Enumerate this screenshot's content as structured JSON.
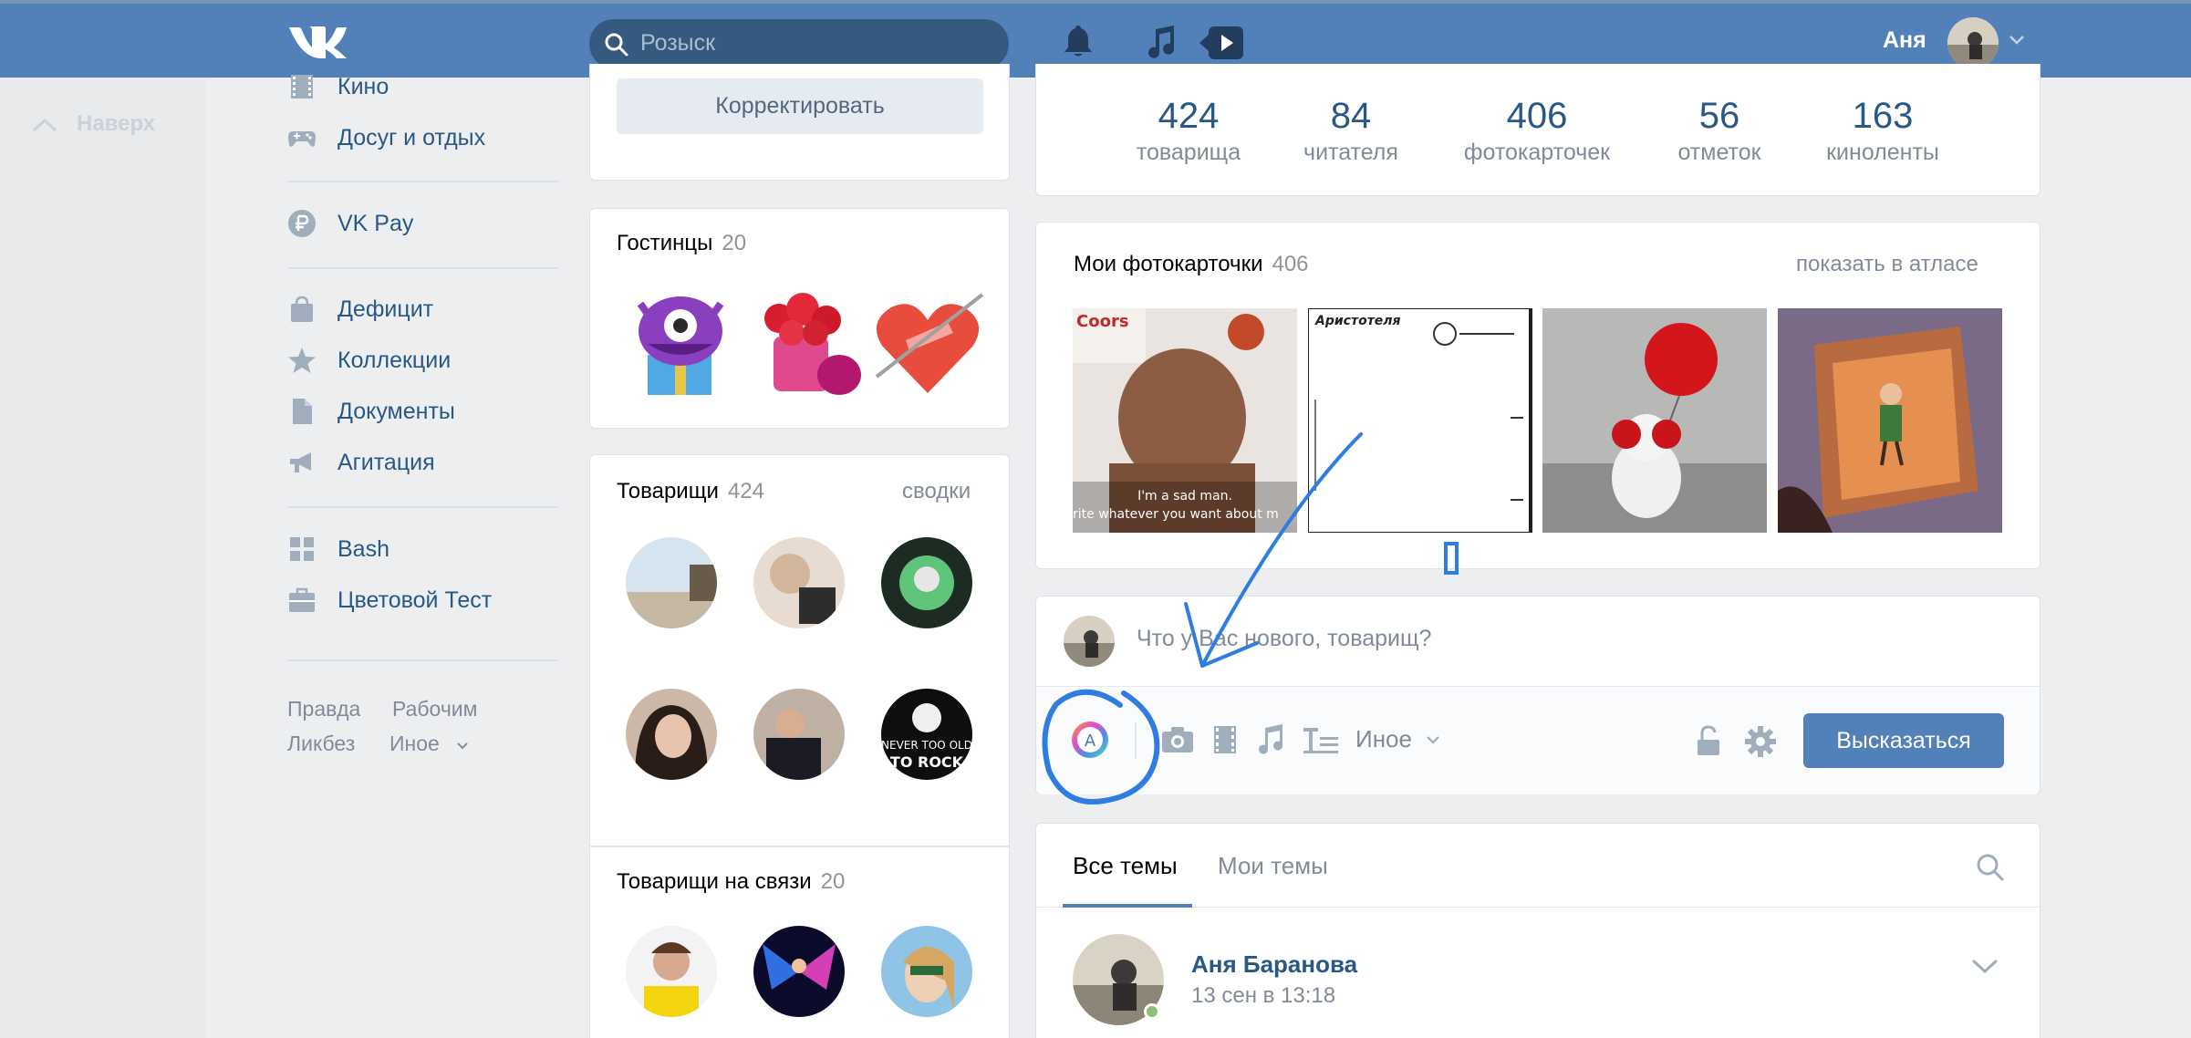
{
  "header": {
    "logo": "VK",
    "search_placeholder": "Розыск",
    "user_name": "Аня"
  },
  "back_to_top": "Наверх",
  "left_menu": {
    "items": [
      {
        "label": "Кино",
        "icon": "film-icon"
      },
      {
        "label": "Досуг и отдых",
        "icon": "gamepad-icon"
      },
      {
        "label": "VK Pay",
        "icon": "ruble-icon"
      },
      {
        "label": "Дефицит",
        "icon": "bag-icon"
      },
      {
        "label": "Коллекции",
        "icon": "star-icon"
      },
      {
        "label": "Документы",
        "icon": "document-icon"
      },
      {
        "label": "Агитация",
        "icon": "megaphone-icon"
      },
      {
        "label": "Bash",
        "icon": "apps-icon"
      },
      {
        "label": "Цветовой Тест",
        "icon": "briefcase-icon"
      }
    ],
    "footer": [
      "Правда",
      "Рабочим",
      "Ликбез",
      "Иное"
    ]
  },
  "profile": {
    "edit_button": "Корректировать"
  },
  "gifts": {
    "title": "Гостинцы",
    "count": "20"
  },
  "friends": {
    "title": "Товарищи",
    "count": "424",
    "link": "сводки"
  },
  "friends_online": {
    "title": "Товарищи на связи",
    "count": "20"
  },
  "stats": [
    {
      "value": "424",
      "label": "товарища"
    },
    {
      "value": "84",
      "label": "читателя"
    },
    {
      "value": "406",
      "label": "фотокарточек"
    },
    {
      "value": "56",
      "label": "отметок"
    },
    {
      "value": "163",
      "label": "киноленты"
    }
  ],
  "photos": {
    "title": "Мои фотокарточки",
    "count": "406",
    "link": "показать в атласе",
    "items": [
      {
        "caption_line1": "I'm a sad man.",
        "caption_line2": "rite whatever you want about m"
      },
      {
        "caption_line1": "Аристотеля",
        "caption_line2": ""
      },
      {
        "caption_line1": "",
        "caption_line2": ""
      },
      {
        "caption_line1": "",
        "caption_line2": ""
      }
    ]
  },
  "composer": {
    "placeholder": "Что у Вас нового, товарищ?",
    "more": "Иное",
    "post_button": "Высказаться"
  },
  "feed": {
    "tabs": [
      "Все темы",
      "Мои темы"
    ],
    "post_author": "Аня Баранова",
    "post_time": "13 сен в 13:18"
  },
  "colors": {
    "header": "#5181b8",
    "link": "#2a5885",
    "annotation": "#2f7de1"
  }
}
